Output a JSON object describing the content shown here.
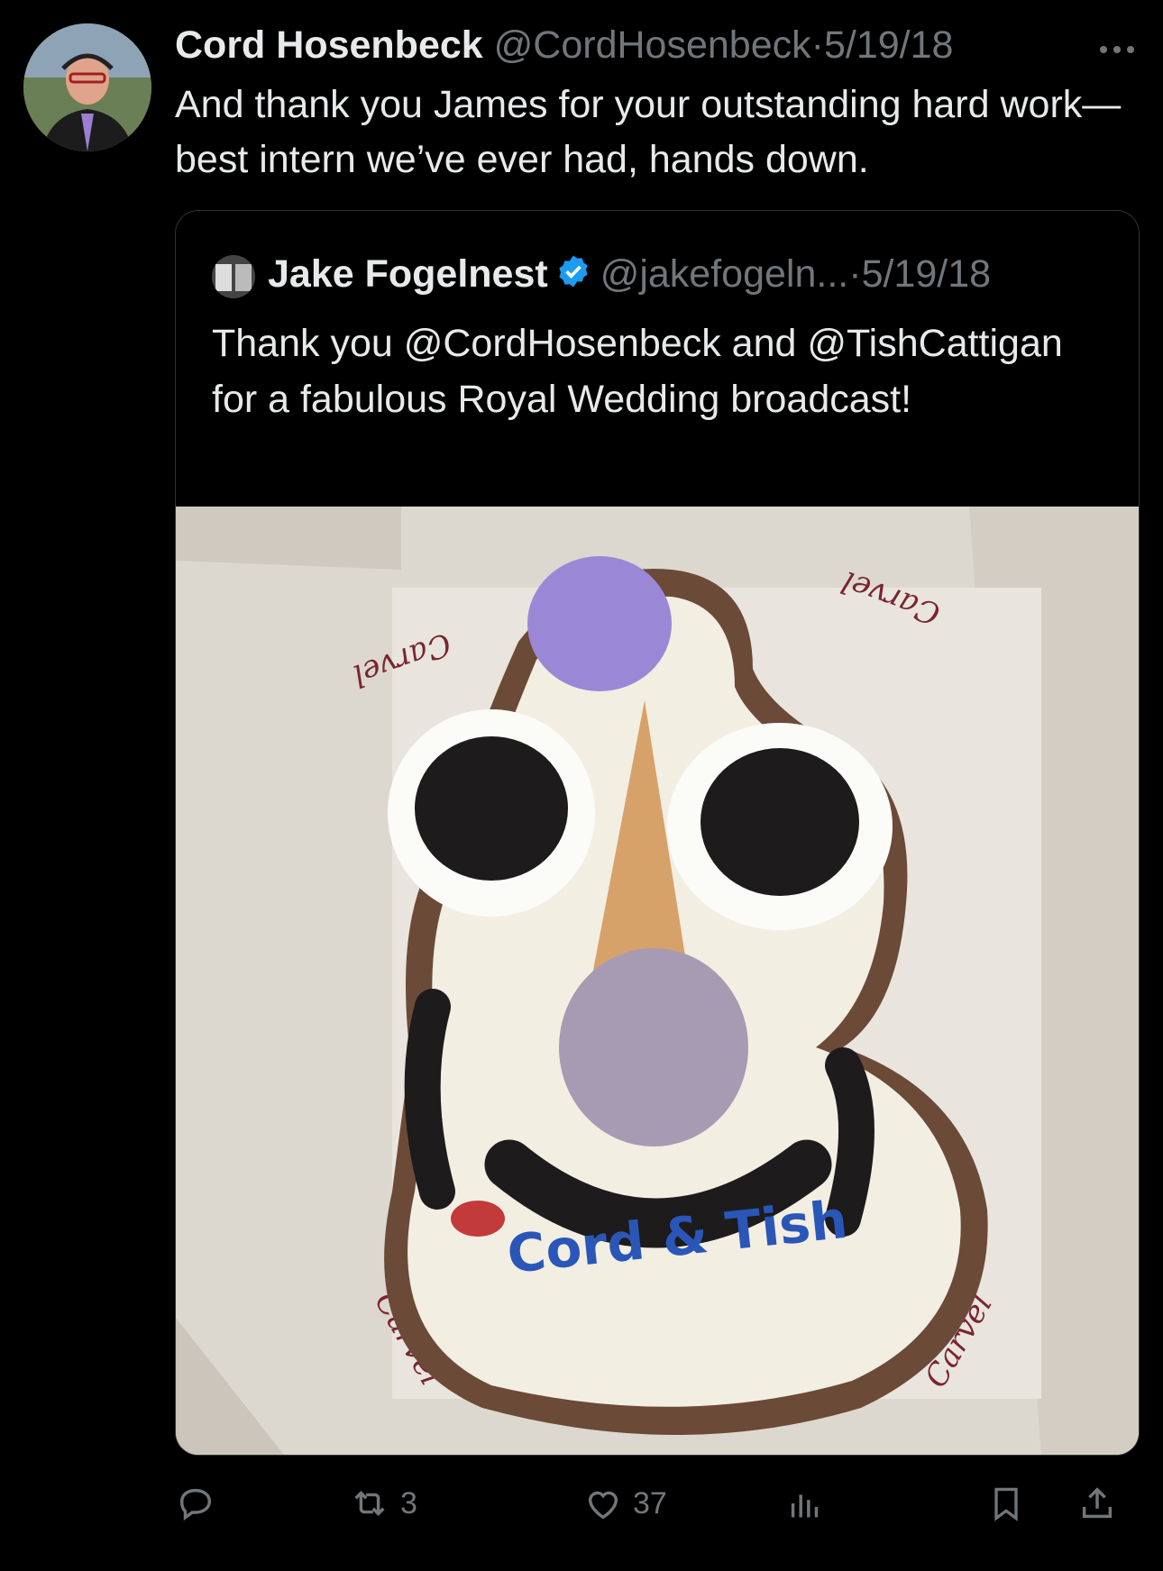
{
  "tweet": {
    "author_name": "Cord Hosenbeck",
    "author_handle": "@CordHosenbeck",
    "separator": "·",
    "date": "5/19/18",
    "more_icon": "more-icon",
    "text": "And thank you James for your outstanding hard work— best intern we’ve ever had, hands down."
  },
  "quoted": {
    "author_name": "Jake Fogelnest",
    "verified": true,
    "author_handle": "@jakefogeln...",
    "separator": "·",
    "date": "5/19/18",
    "text": "Thank you @CordHosenbeck and @TishCattigan for a fabulous Royal Wedding broadcast!",
    "media": {
      "cake_writing": "Cord & Tish",
      "box_brand": "Carvel"
    }
  },
  "actions": {
    "reply_icon": "reply-icon",
    "retweet_count": "3",
    "like_count": "37",
    "views_icon": "views-icon",
    "bookmark_icon": "bookmark-icon",
    "share_icon": "share-icon"
  },
  "colors": {
    "background": "#000000",
    "text": "#e7e9ea",
    "secondary": "#71767b",
    "verified": "#1d9bf0"
  }
}
